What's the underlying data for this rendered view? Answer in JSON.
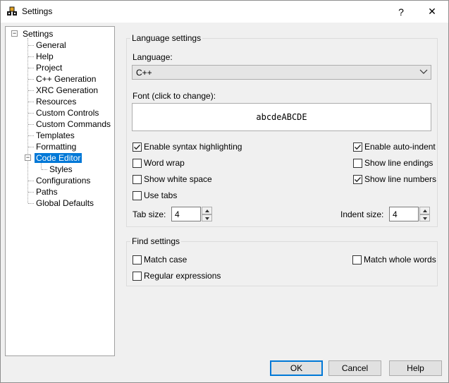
{
  "window": {
    "title": "Settings",
    "help_glyph": "?",
    "close_glyph": "✕"
  },
  "tree": {
    "root": "Settings",
    "items": [
      {
        "label": "General"
      },
      {
        "label": "Help"
      },
      {
        "label": "Project"
      },
      {
        "label": "C++ Generation"
      },
      {
        "label": "XRC Generation"
      },
      {
        "label": "Resources"
      },
      {
        "label": "Custom Controls"
      },
      {
        "label": "Custom Commands"
      },
      {
        "label": "Templates"
      },
      {
        "label": "Formatting"
      },
      {
        "label": "Code Editor",
        "selected": true,
        "child": "Styles"
      },
      {
        "label": "Configurations"
      },
      {
        "label": "Paths"
      },
      {
        "label": "Global Defaults"
      }
    ],
    "expander_root": "−",
    "expander_code_editor": "−"
  },
  "language": {
    "group_title": "Language settings",
    "language_label": "Language:",
    "language_value": "C++",
    "font_label": "Font (click to change):",
    "font_preview": "abcdeABCDE",
    "checkboxes": {
      "syntax": {
        "label": "Enable syntax highlighting",
        "checked": true
      },
      "autoindent": {
        "label": "Enable auto-indent",
        "checked": true
      },
      "wordwrap": {
        "label": "Word wrap",
        "checked": false
      },
      "lineendings": {
        "label": "Show line endings",
        "checked": false
      },
      "whitespace": {
        "label": "Show white space",
        "checked": false
      },
      "linenumbers": {
        "label": "Show line numbers",
        "checked": true
      },
      "usetabs": {
        "label": "Use tabs",
        "checked": false
      }
    },
    "tab_size_label": "Tab size:",
    "tab_size_value": "4",
    "indent_size_label": "Indent size:",
    "indent_size_value": "4"
  },
  "find": {
    "group_title": "Find settings",
    "match_case": {
      "label": "Match case",
      "checked": false
    },
    "match_whole": {
      "label": "Match whole words",
      "checked": false
    },
    "regex": {
      "label": "Regular expressions",
      "checked": false
    }
  },
  "buttons": {
    "ok": "OK",
    "cancel": "Cancel",
    "help": "Help"
  },
  "colors": {
    "accent": "#0078d7",
    "window_bg": "#f0f0f0"
  }
}
